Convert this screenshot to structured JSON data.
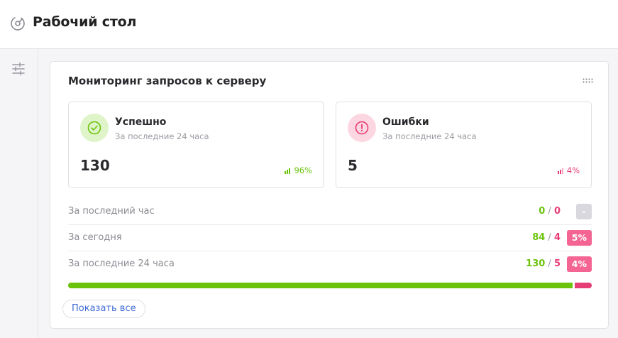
{
  "header": {
    "title": "Рабочий стол",
    "icon": "gauge-icon"
  },
  "sidebar": {
    "icon": "sliders-icon"
  },
  "widget": {
    "title": "Мониторинг запросов к серверу",
    "success": {
      "label": "Успешно",
      "period": "За последние 24 часа",
      "count": "130",
      "percent": "96%",
      "color": "#6cc30c"
    },
    "errors": {
      "label": "Ошибки",
      "period": "За последние 24 часа",
      "count": "5",
      "percent": "4%",
      "color": "#e73d76"
    },
    "rows": [
      {
        "label": "За последний час",
        "ok": "0",
        "err": "0",
        "rate": "-"
      },
      {
        "label": "За сегодня",
        "ok": "84",
        "err": "4",
        "rate": "5%"
      },
      {
        "label": "За последние 24 часа",
        "ok": "130",
        "err": "5",
        "rate": "4%"
      }
    ],
    "progress": {
      "success_fraction": 0.963,
      "error_fraction": 0.037
    },
    "show_all_label": "Показать все"
  }
}
